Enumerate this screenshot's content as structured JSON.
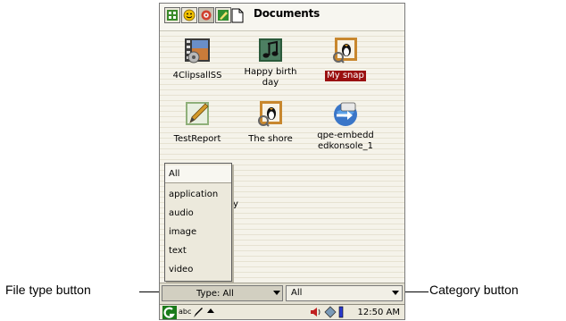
{
  "window": {
    "title": "Documents"
  },
  "tabs": [
    {
      "icon": "grid-apps-icon",
      "color": "#3a8a2a"
    },
    {
      "icon": "smiley-icon",
      "color": "#e0b000"
    },
    {
      "icon": "settings-icon",
      "color": "#c03020"
    },
    {
      "icon": "edit-green-icon",
      "color": "#2f8f2f"
    },
    {
      "icon": "document-icon",
      "color": "#000000"
    }
  ],
  "documents": [
    {
      "label": "4ClipsallSS",
      "icon": "video-film-icon",
      "selected": false
    },
    {
      "label": "Happy birth day",
      "icon": "music-icon",
      "selected": false
    },
    {
      "label": "My snap",
      "icon": "penguin-image-icon",
      "selected": true
    },
    {
      "label": "TestReport",
      "icon": "pencil-document-icon",
      "selected": false
    },
    {
      "label": "The shore",
      "icon": "penguin-image-icon",
      "selected": false
    },
    {
      "label": "qpe-embeddedkonsole_1",
      "icon": "globe-arrow-icon",
      "selected": false
    }
  ],
  "labels": {
    "doc0": "4ClipsallSS",
    "doc1a": "Happy birth",
    "doc1b": "day",
    "doc2": "My snap",
    "doc3": "TestReport",
    "doc4": "The shore",
    "doc5a": "qpe-embedd",
    "doc5b": "edkonsole_1"
  },
  "filetype_menu": {
    "options": [
      "All",
      "application",
      "audio",
      "image",
      "text",
      "video"
    ],
    "stray_char": "y"
  },
  "filetype_combo": {
    "value": "Type: All"
  },
  "category_combo": {
    "value": "All"
  },
  "taskbar": {
    "time": "12:50 AM",
    "input_method": "abc"
  },
  "callouts": {
    "left": "File type button",
    "right": "Category button"
  },
  "colors": {
    "selection": "#9a1010",
    "background": "#f2f0e7"
  }
}
